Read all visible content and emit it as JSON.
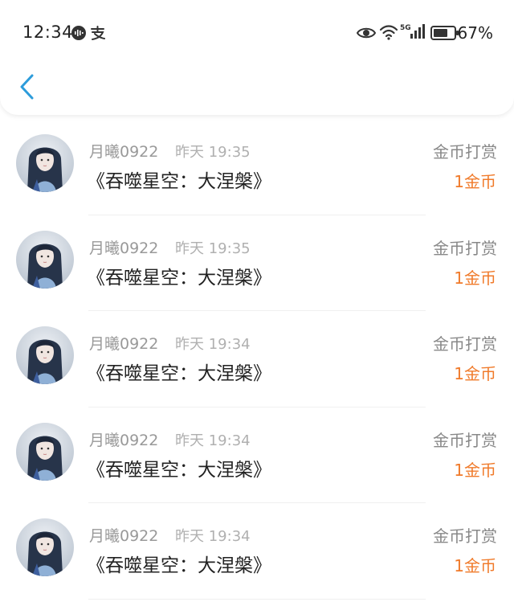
{
  "status_bar": {
    "time": "12:34",
    "battery_percent": "67%",
    "network": "5G"
  },
  "header": {
    "back_icon": "chevron-left-icon",
    "accent_color": "#2d9cdb"
  },
  "records": [
    {
      "user": "月曦0922",
      "time": "昨天 19:35",
      "book": "《吞噬星空：大涅槃》",
      "type": "金币打赏",
      "amount": "1金币"
    },
    {
      "user": "月曦0922",
      "time": "昨天 19:35",
      "book": "《吞噬星空：大涅槃》",
      "type": "金币打赏",
      "amount": "1金币"
    },
    {
      "user": "月曦0922",
      "time": "昨天 19:34",
      "book": "《吞噬星空：大涅槃》",
      "type": "金币打赏",
      "amount": "1金币"
    },
    {
      "user": "月曦0922",
      "time": "昨天 19:34",
      "book": "《吞噬星空：大涅槃》",
      "type": "金币打赏",
      "amount": "1金币"
    },
    {
      "user": "月曦0922",
      "time": "昨天 19:34",
      "book": "《吞噬星空：大涅槃》",
      "type": "金币打赏",
      "amount": "1金币"
    }
  ],
  "colors": {
    "amount": "#f07a2a",
    "secondary_text": "#999999"
  }
}
